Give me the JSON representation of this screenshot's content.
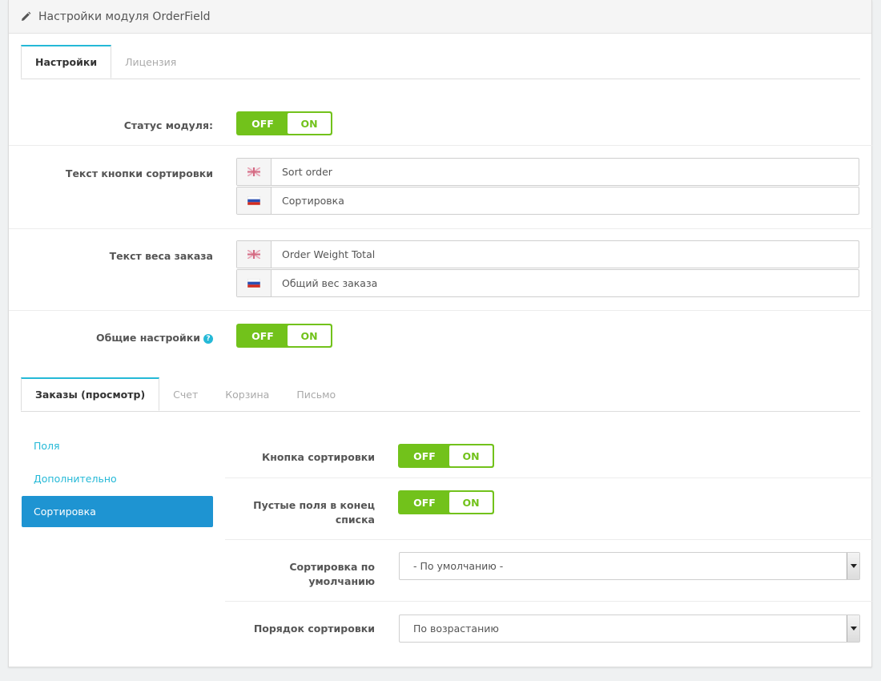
{
  "header": {
    "title": "Настройки модуля OrderField",
    "icon": "pencil-icon"
  },
  "tabs_top": [
    {
      "label": "Настройки",
      "active": true
    },
    {
      "label": "Лицензия",
      "active": false
    }
  ],
  "switch_labels": {
    "off": "OFF",
    "on": "ON"
  },
  "module_status": {
    "label": "Статус модуля:"
  },
  "sort_button_text": {
    "label": "Текст кнопки сортировки",
    "en_value": "Sort order",
    "ru_value": "Сортировка"
  },
  "order_weight_text": {
    "label": "Текст веса заказа",
    "en_value": "Order Weight Total",
    "ru_value": "Общий вес заказа"
  },
  "general_settings": {
    "label": "Общие настройки",
    "help_icon": "question-icon"
  },
  "tabs_bottom": [
    {
      "label": "Заказы (просмотр)",
      "active": true
    },
    {
      "label": "Счет",
      "active": false
    },
    {
      "label": "Корзина",
      "active": false
    },
    {
      "label": "Письмо",
      "active": false
    }
  ],
  "sidebar": {
    "items": [
      {
        "label": "Поля",
        "active": false
      },
      {
        "label": "Дополнительно",
        "active": false
      },
      {
        "label": "Сортировка",
        "active": true
      }
    ]
  },
  "sorting": {
    "sort_button": {
      "label": "Кнопка сортировки"
    },
    "empty_last": {
      "label_line1": "Пустые поля в конец",
      "label_line2": "списка"
    },
    "default_sort": {
      "label_line1": "Сортировка по",
      "label_line2": "умолчанию",
      "value": "- По умолчанию -"
    },
    "sort_order": {
      "label": "Порядок сортировки",
      "value": "По возрастанию"
    }
  },
  "colors": {
    "switch_green": "#72c21b",
    "accent_blue": "#25b9d7",
    "active_blue": "#1e94d2"
  }
}
